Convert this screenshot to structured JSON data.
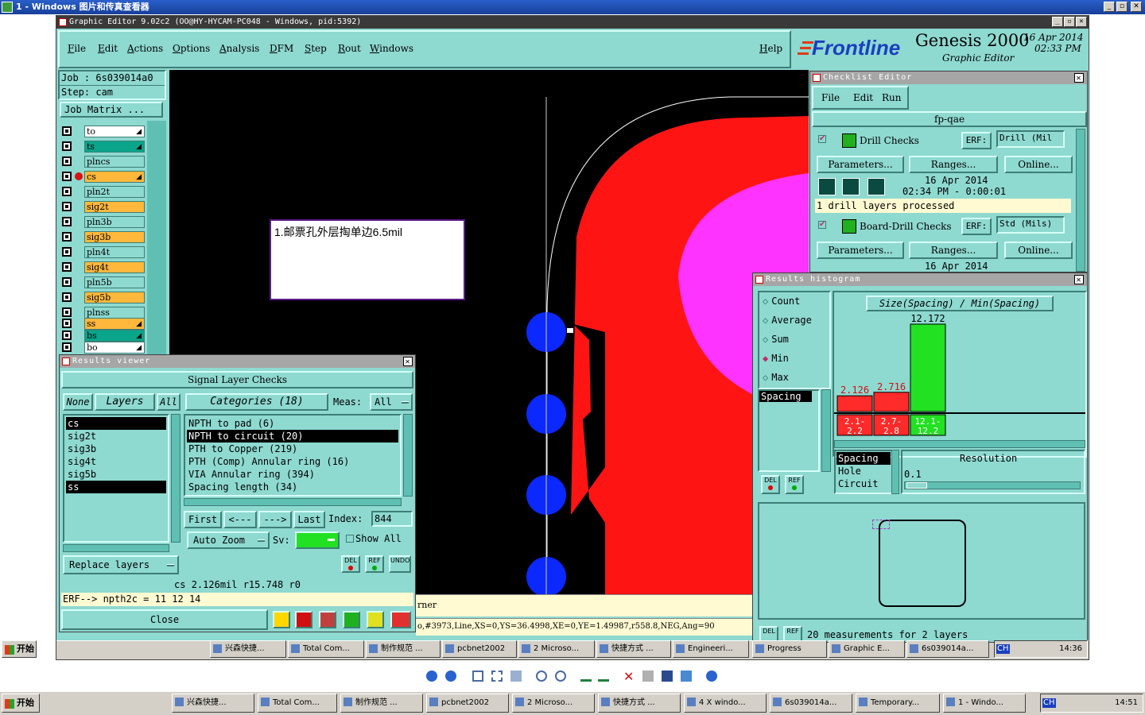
{
  "viewer": {
    "title": "1 - Windows 图片和传真查看器"
  },
  "genesis": {
    "title": "Graphic Editor 9.02c2  (OO@HY-HYCAM-PC048 - Windows, pid:5392)",
    "menu": [
      "File",
      "Edit",
      "Actions",
      "Options",
      "Analysis",
      "DFM",
      "Step",
      "Rout",
      "Windows"
    ],
    "help": "Help",
    "brand": {
      "logo": "Frontline",
      "product": "Genesis 2000",
      "subtitle": "Graphic Editor",
      "date": "16 Apr 2014",
      "time": "02:33  PM"
    },
    "job": "Job  :  6s039014a0",
    "step": "Step:  cam",
    "job_matrix": "Job Matrix ...",
    "layers": [
      {
        "name": "to",
        "color": "#ffffff",
        "arrow": true
      },
      {
        "name": "ts",
        "color": "#0aa58a",
        "arrow": true
      },
      {
        "name": "plncs",
        "color": "#8ed9d0",
        "arrow": false
      },
      {
        "name": "cs",
        "color": "#ffb83c",
        "arrow": true,
        "active": true
      },
      {
        "name": "pln2t",
        "color": "#8ed9d0",
        "arrow": false
      },
      {
        "name": "sig2t",
        "color": "#ffb83c",
        "arrow": false
      },
      {
        "name": "pln3b",
        "color": "#8ed9d0",
        "arrow": false
      },
      {
        "name": "sig3b",
        "color": "#ffb83c",
        "arrow": false
      },
      {
        "name": "pln4t",
        "color": "#8ed9d0",
        "arrow": false
      },
      {
        "name": "sig4t",
        "color": "#ffb83c",
        "arrow": false
      },
      {
        "name": "pln5b",
        "color": "#8ed9d0",
        "arrow": false
      },
      {
        "name": "sig5b",
        "color": "#ffb83c",
        "arrow": false
      },
      {
        "name": "plnss",
        "color": "#8ed9d0",
        "arrow": false
      },
      {
        "name": "ss",
        "color": "#ffb83c",
        "arrow": true
      },
      {
        "name": "bs",
        "color": "#0aa58a",
        "arrow": true
      },
      {
        "name": "bo",
        "color": "#ffffff",
        "arrow": true
      }
    ],
    "annotation": "1.邮票孔外层掏单边6.5mil",
    "status_line1": "rner",
    "status_line2": "o,#3973,Line,XS=0,YS=36.4998,XE=0,YE=1.49987,r558.8,NEG,Ang=90"
  },
  "results_viewer": {
    "title": "Results viewer",
    "header": "Signal Layer Checks",
    "none_btn": "None",
    "layers_label": "Layers",
    "all_btn": "All",
    "categories_label": "Categories (18)",
    "meas_label": "Meas:",
    "meas_value": "All",
    "layer_list": [
      {
        "name": "cs",
        "selected": true
      },
      {
        "name": "sig2t",
        "selected": false
      },
      {
        "name": "sig3b",
        "selected": false
      },
      {
        "name": "sig4t",
        "selected": false
      },
      {
        "name": "sig5b",
        "selected": false
      },
      {
        "name": "ss",
        "selected": true
      }
    ],
    "categories": [
      {
        "name": "NPTH to pad (6)",
        "selected": false
      },
      {
        "name": "NPTH to circuit (20)",
        "selected": true
      },
      {
        "name": "PTH to Copper (219)",
        "selected": false
      },
      {
        "name": "PTH (Comp) Annular ring (16)",
        "selected": false
      },
      {
        "name": "VIA Annular ring (394)",
        "selected": false
      },
      {
        "name": "Spacing length (34)",
        "selected": false
      }
    ],
    "nav": {
      "first": "First",
      "prev": "<---",
      "next": "--->",
      "last": "Last",
      "index_label": "Index:",
      "index_value": "844"
    },
    "auto_zoom": "Auto Zoom",
    "sv_label": "Sv:",
    "show_all": "Show All",
    "replace_layers": "Replace layers",
    "del": "DEL",
    "ref": "REF",
    "undo": "UNDO",
    "measure_line": "cs 2.126mil  r15.748  r0",
    "erf_line": "ERF--> npth2c = 11 12 14",
    "close": "Close"
  },
  "checklist": {
    "title": "Checklist Editor",
    "menu": [
      "File",
      "Edit",
      "Run"
    ],
    "name": "fp-qae",
    "items": [
      {
        "name": "Drill Checks",
        "erf": "ERF:",
        "erf_value": "Drill (Mil",
        "params": "Parameters...",
        "ranges": "Ranges...",
        "online": "Online...",
        "date": "16 Apr 2014",
        "time": "02:34 PM - 0:00:01",
        "status": "1 drill layers processed"
      },
      {
        "name": "Board-Drill Checks",
        "erf": "ERF:",
        "erf_value": "Std (Mils)",
        "params": "Parameters...",
        "ranges": "Ranges...",
        "online": "Online...",
        "date": "16 Apr 2014"
      }
    ]
  },
  "histogram": {
    "title": "Results histogram",
    "options": [
      {
        "label": "Count",
        "selected": false
      },
      {
        "label": "Average",
        "selected": false
      },
      {
        "label": "Sum",
        "selected": false
      },
      {
        "label": "Min",
        "selected": true
      },
      {
        "label": "Max",
        "selected": false
      }
    ],
    "graph_title": "Size(Spacing) / Min(Spacing)",
    "spacing_label": "Spacing",
    "bars": [
      {
        "value": "2.126",
        "range": [
          "2.1-",
          "2.2"
        ],
        "color": "#ff2a2a",
        "level": 0.18
      },
      {
        "value": "2.716",
        "range": [
          "2.7-",
          "2.8"
        ],
        "color": "#ff2a2a",
        "level": 0.22
      },
      {
        "value": "12.172",
        "range": [
          "12.1-",
          "12.2"
        ],
        "color": "#22e022",
        "level": 1.0
      }
    ],
    "types": [
      "Spacing",
      "Hole",
      "Circuit"
    ],
    "resolution_label": "Resolution",
    "resolution_value": "0.1",
    "del": "DEL",
    "ref": "REF",
    "footer": "20 measurements for 2 layers"
  },
  "inner_taskbar": {
    "start": "开始",
    "items": [
      "兴森快捷...",
      "Total Com...",
      "制作规范 ...",
      "pcbnet2002",
      "2 Microso...",
      "快捷方式 ...",
      "Engineeri...",
      "Progress",
      "Graphic E...",
      "6s039014a..."
    ],
    "lang": "CH",
    "time": "14:36"
  },
  "outer_taskbar": {
    "start": "开始",
    "items": [
      "兴森快捷...",
      "Total Com...",
      "制作规范 ...",
      "pcbnet2002",
      "2 Microso...",
      "快捷方式 ...",
      "4 X windo...",
      "6s039014a...",
      "Temporary...",
      "1 - Windo..."
    ],
    "lang": "CH",
    "time": "14:51"
  }
}
